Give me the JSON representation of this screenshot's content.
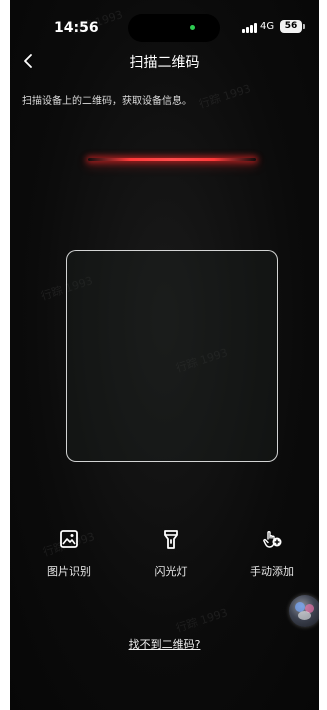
{
  "status_bar": {
    "time": "14:56",
    "network": "4G",
    "battery": "56"
  },
  "nav": {
    "title": "扫描二维码",
    "back_icon": "chevron-left-icon"
  },
  "instruction": "扫描设备上的二维码，获取设备信息。",
  "watermark": "行踪 1993",
  "actions": [
    {
      "label": "图片识别",
      "icon": "image-icon"
    },
    {
      "label": "闪光灯",
      "icon": "flashlight-icon"
    },
    {
      "label": "手动添加",
      "icon": "hand-add-icon"
    }
  ],
  "help_link": "找不到二维码?",
  "colors": {
    "background": "#0b0b0b",
    "scan_line": "#ff3a3a",
    "status_dot": "#2ecc52"
  }
}
